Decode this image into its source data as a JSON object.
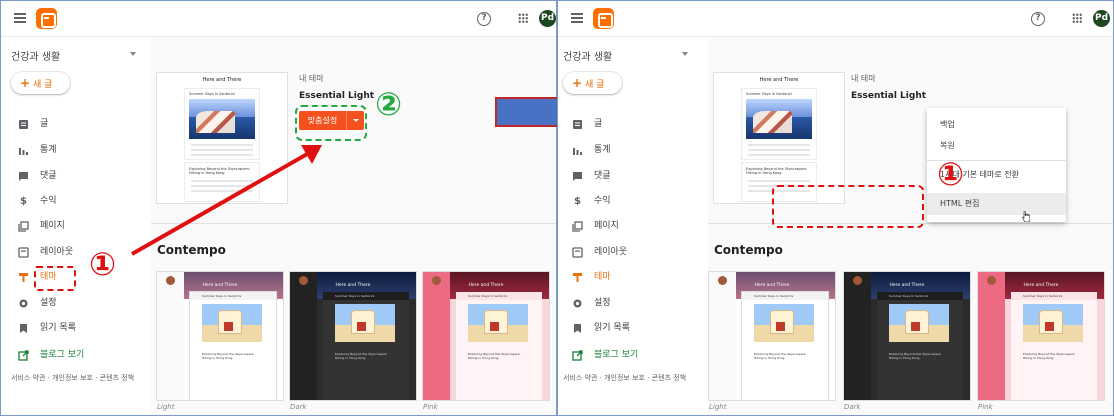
{
  "app": {
    "blog_name": "건강과 생활",
    "new_post": "새 글",
    "avatar_initials": "Pd"
  },
  "nav": [
    {
      "label": "글",
      "icon": "posts-icon"
    },
    {
      "label": "통계",
      "icon": "stats-icon"
    },
    {
      "label": "댓글",
      "icon": "comments-icon"
    },
    {
      "label": "수익",
      "icon": "earnings-icon"
    },
    {
      "label": "페이지",
      "icon": "pages-icon"
    },
    {
      "label": "레이아웃",
      "icon": "layout-icon"
    },
    {
      "label": "테마",
      "icon": "theme-icon"
    },
    {
      "label": "설정",
      "icon": "settings-icon"
    },
    {
      "label": "읽기 목록",
      "icon": "reading-list-icon"
    }
  ],
  "view_blog": "블로그 보기",
  "footer": "서비스 약관 · 개인정보 보호 · 콘텐츠 정책",
  "current_theme": {
    "section_label": "내 테마",
    "name": "Essential Light",
    "customize_label": "맞춤설정",
    "thumb_title": "Here and There",
    "post1_title": "Summer Days In Santorini",
    "post2_title": "Exploring Beyond the Skyscrapers: Hiking in Hong Kong"
  },
  "theme_group": "Contempo",
  "themes": [
    {
      "label": "Light",
      "header_title": "Here and There"
    },
    {
      "label": "Dark",
      "header_title": "Here and There"
    },
    {
      "label": "Pink",
      "header_title": "Here and There"
    }
  ],
  "theme_card_post": "Summer Days In Santorini",
  "theme_card_post2": "Exploring Beyond the Skyscrapers: Hiking in Hong Kong",
  "menu": {
    "backup": "백업",
    "restore": "복원",
    "switch_classic": "1세대 기본 테마로 전환",
    "edit_html": "HTML 편집"
  },
  "annotations": {
    "step1": "①",
    "step2": "②"
  },
  "colors": {
    "accent": "#f4511e",
    "annotation_red": "#e01010",
    "annotation_green": "#22aa44",
    "arrow_blue": "#4a72c4"
  }
}
